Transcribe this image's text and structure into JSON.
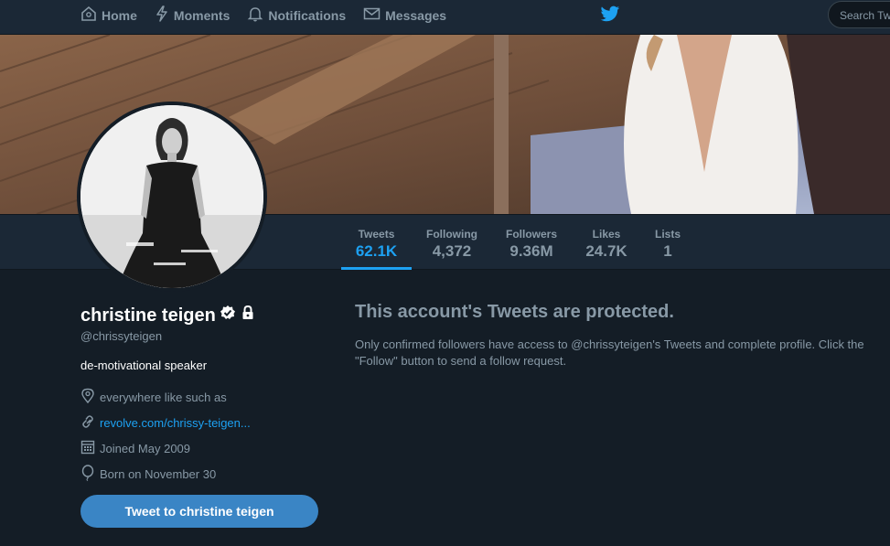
{
  "nav": {
    "items": [
      {
        "label": "Home",
        "icon": "home-icon"
      },
      {
        "label": "Moments",
        "icon": "lightning-icon"
      },
      {
        "label": "Notifications",
        "icon": "bell-icon"
      },
      {
        "label": "Messages",
        "icon": "envelope-icon"
      }
    ],
    "search_placeholder": "Search Twitter"
  },
  "stats": [
    {
      "label": "Tweets",
      "value": "62.1K",
      "active": true
    },
    {
      "label": "Following",
      "value": "4,372"
    },
    {
      "label": "Followers",
      "value": "9.36M"
    },
    {
      "label": "Likes",
      "value": "24.7K"
    },
    {
      "label": "Lists",
      "value": "1"
    }
  ],
  "profile": {
    "name": "christine teigen",
    "handle": "@chrissyteigen",
    "bio": "de-motivational speaker",
    "location": "everywhere like such as",
    "url": "revolve.com/chrissy-teigen...",
    "joined": "Joined May 2009",
    "birthday": "Born on November 30",
    "tweet_button": "Tweet to christine teigen"
  },
  "protected": {
    "title": "This account's Tweets are protected.",
    "text": "Only confirmed followers have access to @chrissyteigen's Tweets and complete profile. Click the \"Follow\" button to send a follow request."
  },
  "colors": {
    "background": "#141d26",
    "bar": "#1b2836",
    "accent": "#1da1f2",
    "muted": "#8899a6"
  }
}
